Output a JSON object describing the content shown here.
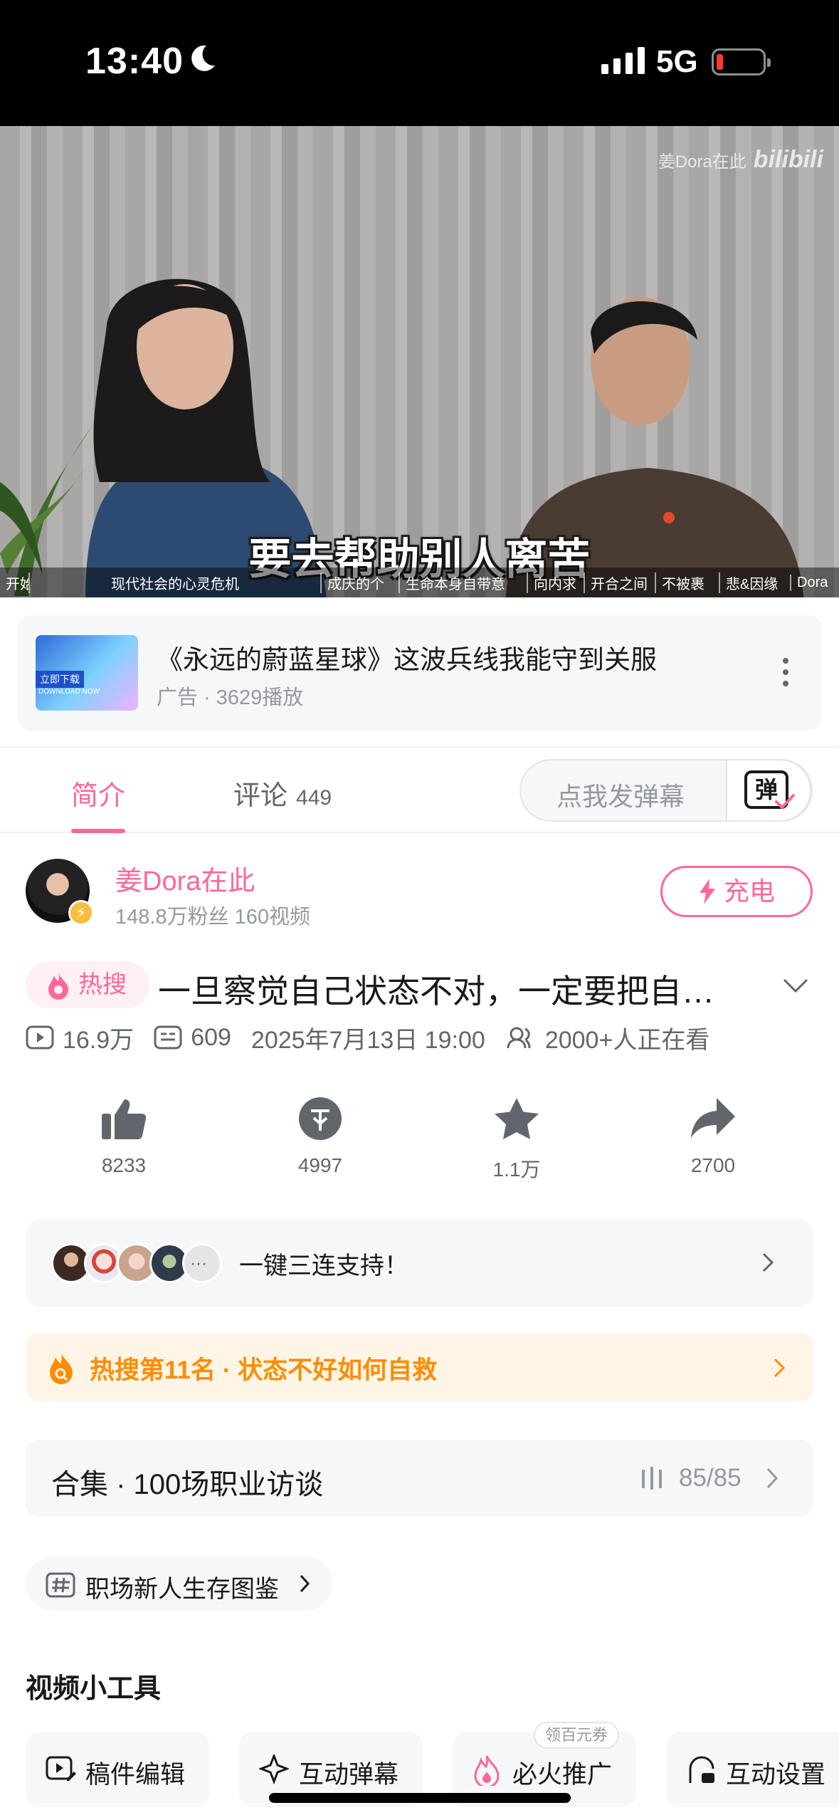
{
  "status_bar": {
    "time": "13:40",
    "network": "5G"
  },
  "video": {
    "watermark_name": "姜Dora在此",
    "watermark_logo": "bilibili",
    "subtitle": "要去帮助别人离苦",
    "chapters": [
      "开始",
      "现代社会的心灵危机",
      "成庆的个",
      "生命本身自带意",
      "向内求",
      "开合之间",
      "不被裹",
      "悲&因缘",
      "Dora"
    ]
  },
  "ad": {
    "thumb_tag": "立即下载",
    "thumb_sub": "DOWNLOAD NOW",
    "title": "《永远的蔚蓝星球》这波兵线我能守到关服",
    "meta": "广告 · 3629播放"
  },
  "tabs": {
    "intro": "简介",
    "comments": "评论",
    "comment_count": "449",
    "danmu_placeholder": "点我发弹幕",
    "danmu_icon": "弹"
  },
  "uploader": {
    "name": "姜Dora在此",
    "meta": "148.8万粉丝  160视频",
    "charge": "充电"
  },
  "video_info": {
    "hot_badge": "热搜",
    "title": "一旦察觉自己状态不对，一定要把自…",
    "views": "16.9万",
    "danmaku": "609",
    "date": "2025年7月13日 19:00",
    "watching": "2000+人正在看"
  },
  "actions": [
    {
      "icon": "like-icon",
      "count": "8233"
    },
    {
      "icon": "coin-icon",
      "count": "4997"
    },
    {
      "icon": "favorite-icon",
      "count": "1.1万"
    },
    {
      "icon": "share-icon",
      "count": "2700"
    }
  ],
  "triple": {
    "label": "一键三连支持！"
  },
  "hot_rank": {
    "label": "热搜第11名 · 状态不好如何自救"
  },
  "collection": {
    "label": "合集 · 100场职业访谈",
    "count": "85/85"
  },
  "topic": {
    "label": "职场新人生存图鉴"
  },
  "tools": {
    "heading": "视频小工具",
    "items": [
      "稿件编辑",
      "互动弹幕",
      "必火推广",
      "互动设置"
    ],
    "coupon": "领百元券"
  },
  "colors": {
    "accent": "#ff6699",
    "hot": "#ff8c00",
    "text": "#18191c",
    "muted": "#9499a0"
  }
}
